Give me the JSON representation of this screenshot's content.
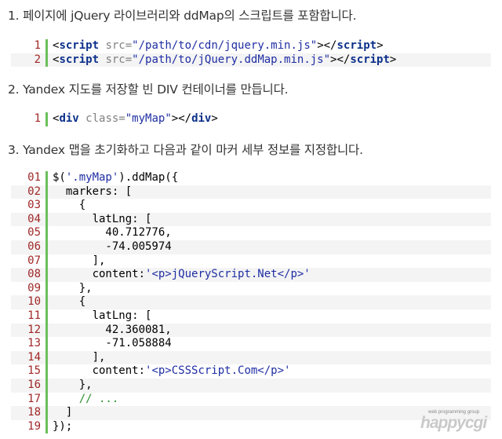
{
  "steps": [
    "1. 페이지에 jQuery 라이브러리와 ddMap의 스크립트를 포함합니다.",
    "2. Yandex 지도를 저장할 빈 DIV 컨테이너를 만듭니다.",
    "3. Yandex 맵을 초기화하고 다음과 같이 마커 세부 정보를 지정합니다."
  ],
  "block1": [
    {
      "n": "1",
      "parts": [
        [
          "<",
          "p"
        ],
        [
          "script",
          "kw"
        ],
        [
          " src=",
          "at"
        ],
        [
          "\"/path/to/cdn/jquery.min.js\"",
          "st"
        ],
        [
          "></",
          "p"
        ],
        [
          "script",
          "kw"
        ],
        [
          ">",
          "p"
        ]
      ]
    },
    {
      "n": "2",
      "parts": [
        [
          "<",
          "p"
        ],
        [
          "script",
          "kw"
        ],
        [
          " src=",
          "at"
        ],
        [
          "\"/path/to/jQuery.ddMap.min.js\"",
          "st"
        ],
        [
          "></",
          "p"
        ],
        [
          "script",
          "kw"
        ],
        [
          ">",
          "p"
        ]
      ]
    }
  ],
  "block2": [
    {
      "n": "1",
      "parts": [
        [
          "<",
          "p"
        ],
        [
          "div",
          "kw"
        ],
        [
          " class=",
          "at"
        ],
        [
          "\"myMap\"",
          "st"
        ],
        [
          "></",
          "p"
        ],
        [
          "div",
          "kw"
        ],
        [
          ">",
          "p"
        ]
      ]
    }
  ],
  "block3": [
    {
      "n": "01",
      "parts": [
        [
          "$(",
          "p"
        ],
        [
          "'.myMap'",
          "st"
        ],
        [
          ").ddMap({",
          "p"
        ]
      ]
    },
    {
      "n": "02",
      "parts": [
        [
          "  markers: [",
          "p"
        ]
      ]
    },
    {
      "n": "03",
      "parts": [
        [
          "    {",
          "p"
        ]
      ]
    },
    {
      "n": "04",
      "parts": [
        [
          "      latLng: [",
          "p"
        ]
      ]
    },
    {
      "n": "05",
      "parts": [
        [
          "        40.712776,",
          "p"
        ]
      ]
    },
    {
      "n": "06",
      "parts": [
        [
          "        -74.005974",
          "p"
        ]
      ]
    },
    {
      "n": "07",
      "parts": [
        [
          "      ],",
          "p"
        ]
      ]
    },
    {
      "n": "08",
      "parts": [
        [
          "      content:",
          "p"
        ],
        [
          "'<p>jQueryScript.Net</p>'",
          "st"
        ]
      ]
    },
    {
      "n": "09",
      "parts": [
        [
          "    },",
          "p"
        ]
      ]
    },
    {
      "n": "10",
      "parts": [
        [
          "    {",
          "p"
        ]
      ]
    },
    {
      "n": "11",
      "parts": [
        [
          "      latLng: [",
          "p"
        ]
      ]
    },
    {
      "n": "12",
      "parts": [
        [
          "        42.360081,",
          "p"
        ]
      ]
    },
    {
      "n": "13",
      "parts": [
        [
          "        -71.058884",
          "p"
        ]
      ]
    },
    {
      "n": "14",
      "parts": [
        [
          "      ],",
          "p"
        ]
      ]
    },
    {
      "n": "15",
      "parts": [
        [
          "      content:",
          "p"
        ],
        [
          "'<p>CSSScript.Com</p>'",
          "st"
        ]
      ]
    },
    {
      "n": "16",
      "parts": [
        [
          "    },",
          "p"
        ]
      ]
    },
    {
      "n": "17",
      "parts": [
        [
          "    ",
          "p"
        ],
        [
          "// ...",
          "cm"
        ]
      ]
    },
    {
      "n": "18",
      "parts": [
        [
          "  ]",
          "p"
        ]
      ]
    },
    {
      "n": "19",
      "parts": [
        [
          "});",
          "p"
        ]
      ]
    }
  ],
  "watermark": {
    "small": "web programming group",
    "big": "happycgi"
  }
}
